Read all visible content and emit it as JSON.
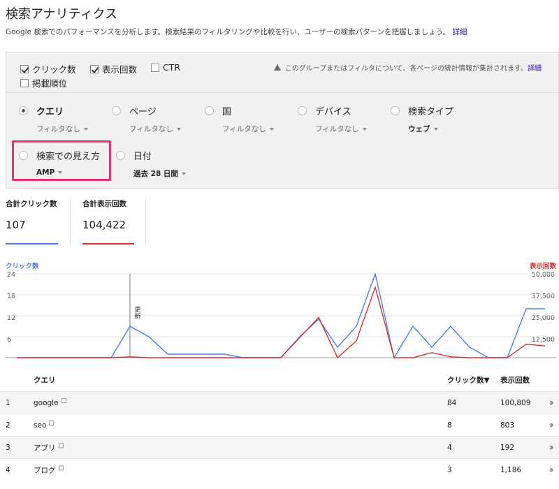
{
  "header": {
    "title": "検索アナリティクス",
    "description": "Google 検索でのパフォーマンスを分析します。検索結果のフィルタリングや比較を行い、ユーザーの検索パターンを把握しましょう。",
    "detail_link": "詳細"
  },
  "metrics": [
    {
      "label": "クリック数",
      "checked": true
    },
    {
      "label": "表示回数",
      "checked": true
    },
    {
      "label": "CTR",
      "checked": false
    },
    {
      "label": "掲載順位",
      "checked": false
    }
  ],
  "notice": {
    "text": "このグループまたはフィルタについて、各ページの統計情報が集計されます。",
    "link": "詳細"
  },
  "dimensions": [
    {
      "label": "クエリ",
      "filter": "フィルタなし",
      "selected": true
    },
    {
      "label": "ページ",
      "filter": "フィルタなし",
      "selected": false
    },
    {
      "label": "国",
      "filter": "フィルタなし",
      "selected": false
    },
    {
      "label": "デバイス",
      "filter": "フィルタなし",
      "selected": false
    },
    {
      "label": "検索タイプ",
      "filter": "ウェブ",
      "selected": false
    },
    {
      "label": "検索での見え方",
      "filter": "AMP",
      "selected": false
    },
    {
      "label": "日付",
      "filter": "過去 28 日間",
      "selected": false
    }
  ],
  "scorecards": [
    {
      "label": "合計クリック数",
      "value": "107",
      "color": "#4a7ff0"
    },
    {
      "label": "合計表示回数",
      "value": "104,422",
      "color": "#d32f2f"
    }
  ],
  "chart_data": {
    "type": "line",
    "left_axis_label": "クリック数",
    "right_axis_label": "表示回数",
    "left_ticks": [
      "24",
      "18",
      "12",
      "6"
    ],
    "right_ticks": [
      "50,000",
      "37,500",
      "25,000",
      "12,500"
    ],
    "ylim_left": [
      0,
      24
    ],
    "ylim_right": [
      0,
      50000
    ],
    "annotation": {
      "index": 6,
      "label": "更新"
    },
    "x": [
      1,
      2,
      3,
      4,
      5,
      6,
      7,
      8,
      9,
      10,
      11,
      12,
      13,
      14,
      15,
      16,
      17,
      18,
      19,
      20,
      21,
      22,
      23,
      24,
      25,
      26,
      27,
      28,
      29
    ],
    "series": [
      {
        "name": "クリック数",
        "axis": "left",
        "color": "#4a7ff0",
        "values": [
          0,
          0,
          0,
          0,
          0,
          0,
          9,
          6,
          1,
          1,
          1,
          1,
          0,
          0,
          0,
          6,
          11,
          3,
          9,
          24,
          0,
          9,
          3,
          9,
          3,
          0,
          0,
          14,
          14
        ]
      },
      {
        "name": "表示回数",
        "axis": "right",
        "color": "#d32f2f",
        "values": [
          0,
          0,
          0,
          0,
          0,
          0,
          500,
          0,
          0,
          0,
          0,
          0,
          0,
          0,
          0,
          12000,
          24000,
          0,
          10000,
          42000,
          0,
          0,
          3000,
          500,
          0,
          0,
          0,
          8000,
          7000
        ]
      }
    ]
  },
  "table": {
    "headers": {
      "rank": "",
      "query": "クエリ",
      "clicks": "クリック数▼",
      "impressions": "表示回数"
    },
    "rows": [
      {
        "rank": "1",
        "query": "google",
        "clicks": "84",
        "impressions": "100,809"
      },
      {
        "rank": "2",
        "query": "seo",
        "clicks": "8",
        "impressions": "803"
      },
      {
        "rank": "3",
        "query": "アプリ",
        "clicks": "4",
        "impressions": "192"
      },
      {
        "rank": "4",
        "query": "ブログ",
        "clicks": "3",
        "impressions": "1,186"
      }
    ]
  }
}
